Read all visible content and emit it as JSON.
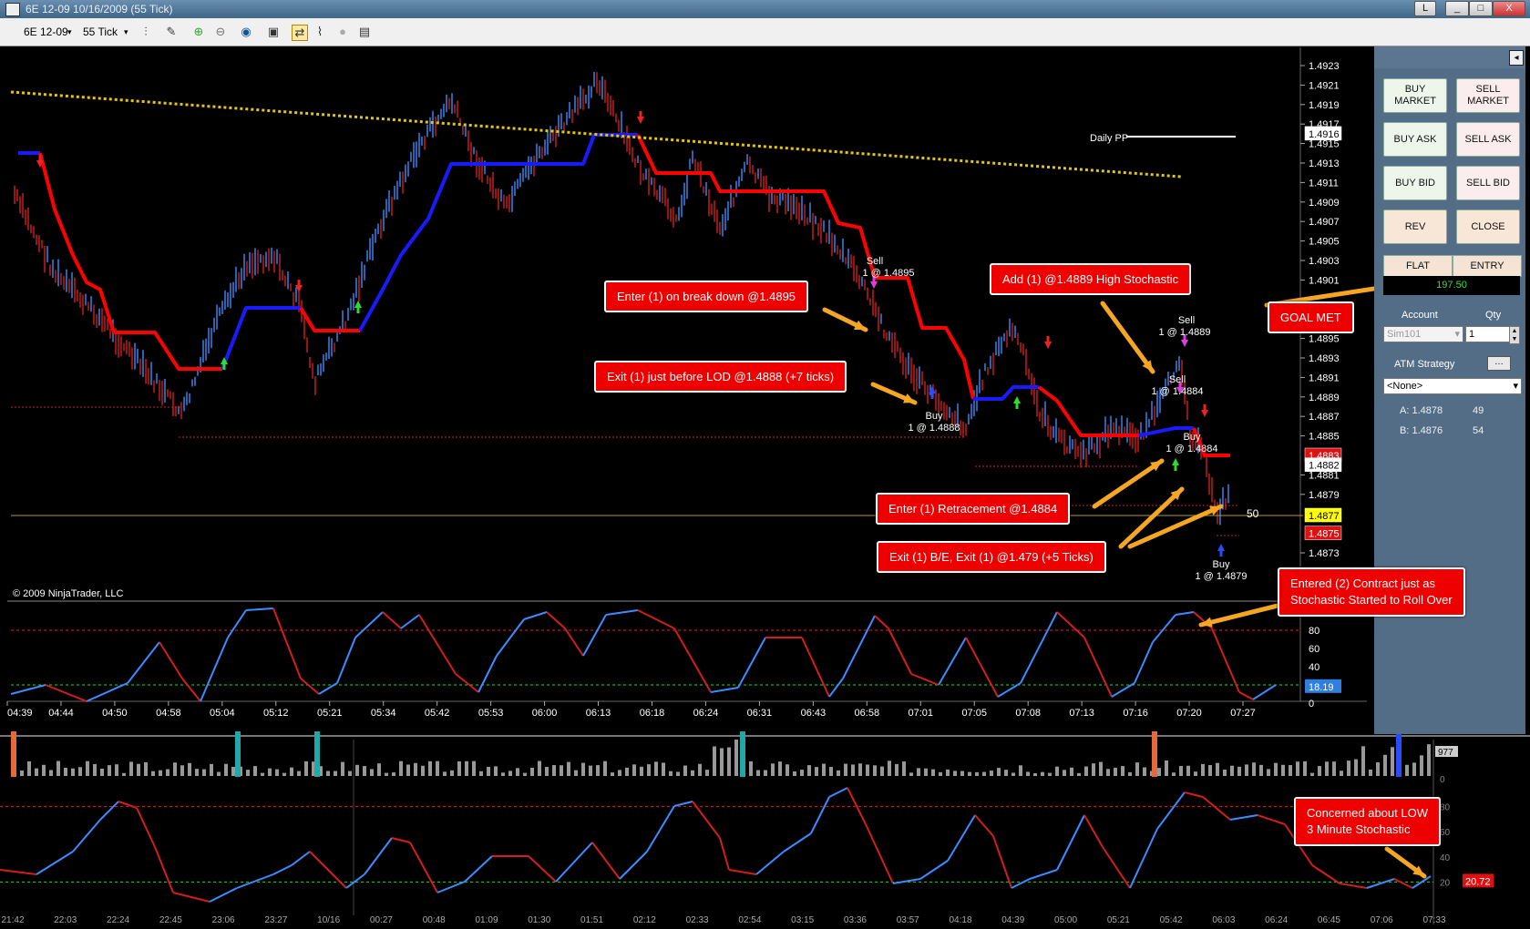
{
  "window": {
    "title": "6E 12-09  10/16/2009 (55 Tick)",
    "buttons": [
      "L",
      "_",
      "□",
      "X"
    ]
  },
  "toolbar": {
    "instrument": "6E 12-09",
    "interval": "55 Tick"
  },
  "chart": {
    "copyright": "© 2009 NinjaTrader, LLC",
    "daily_pp_label": "Daily PP",
    "price_axis": [
      "1.4923",
      "1.4921",
      "1.4919",
      "1.4917",
      "1.4915",
      "1.4913",
      "1.4911",
      "1.4909",
      "1.4907",
      "1.4905",
      "1.4903",
      "1.4901",
      "1.4895",
      "1.4893",
      "1.4891",
      "1.4889",
      "1.4887",
      "1.4885",
      "1.4881",
      "1.4879",
      "1.4873"
    ],
    "price_tags": {
      "ask": "1.4883",
      "last_a": "1.4882",
      "last": "1.4877",
      "bid": "1.4875",
      "pp": "1.4916"
    },
    "range_label": "50",
    "time_axis": [
      "04:39",
      "04:44",
      "04:50",
      "04:58",
      "05:04",
      "05:12",
      "05:21",
      "05:34",
      "05:42",
      "05:53",
      "06:00",
      "06:13",
      "06:18",
      "06:24",
      "06:31",
      "06:43",
      "06:58",
      "07:01",
      "07:05",
      "07:08",
      "07:13",
      "07:16",
      "07:20",
      "07:27"
    ],
    "stoch_axis": [
      "80",
      "60",
      "40",
      "20",
      "0"
    ],
    "stoch_value": "18.19",
    "trade_labels": [
      {
        "side": "Sell",
        "detail": "1 @ 1.4895"
      },
      {
        "side": "Buy",
        "detail": "1 @ 1.4888"
      },
      {
        "side": "Sell",
        "detail": "1 @ 1.4889"
      },
      {
        "side": "Sell",
        "detail": "1 @ 1.4884"
      },
      {
        "side": "Buy",
        "detail": "1 @ 1.4884"
      },
      {
        "side": "Buy",
        "detail": "1 @ 1.4879"
      }
    ]
  },
  "annotations": {
    "enter_break": "Enter (1) on break down @1.4895",
    "exit_lod": "Exit (1) just before LOD @1.4888 (+7 ticks)",
    "add_high": "Add (1) @1.4889 High Stochastic",
    "goal_met": "GOAL MET",
    "enter_retr": "Enter (1) Retracement @1.4884",
    "exit_be": "Exit (1) B/E, Exit (1) @1.479 (+5 Ticks)",
    "entered_two_1": "Entered (2) Contract just as",
    "entered_two_2": "Stochastic Started to Roll Over",
    "concerned_1": "Concerned about LOW",
    "concerned_2": "3 Minute Stochastic"
  },
  "order_panel": {
    "buy_market": "BUY MARKET",
    "sell_market": "SELL MARKET",
    "buy_ask": "BUY ASK",
    "sell_ask": "SELL ASK",
    "buy_bid": "BUY BID",
    "sell_bid": "SELL BID",
    "rev": "REV",
    "close": "CLOSE",
    "flat": "FLAT",
    "entry": "ENTRY",
    "pnl": "197.50",
    "account_label": "Account",
    "qty_label": "Qty",
    "account_value": "Sim101",
    "qty_value": "1",
    "atm_label": "ATM Strategy",
    "atm_value": "<None>",
    "ask_label": "A: 1.4878",
    "ask_size": "49",
    "bid_label": "B: 1.4876",
    "bid_size": "54"
  },
  "lower_chart": {
    "volume_tag": "977",
    "volume_zero": "0",
    "stoch_axis": [
      "80",
      "60",
      "40",
      "20"
    ],
    "stoch_value": "20.72",
    "time_axis": [
      "21:42",
      "22:03",
      "22:24",
      "22:45",
      "23:06",
      "23:27",
      "10/16",
      "00:27",
      "00:48",
      "01:09",
      "01:30",
      "01:51",
      "02:12",
      "02:33",
      "02:54",
      "03:15",
      "03:36",
      "03:57",
      "04:18",
      "04:39",
      "05:00",
      "05:21",
      "05:42",
      "06:03",
      "06:24",
      "06:45",
      "07:06",
      "07:33"
    ]
  },
  "colors": {
    "up_bar": "#3c8cff",
    "down_bar": "#d21e1e",
    "trail_red": "#ff0000",
    "trail_blue": "#1a1aff",
    "pp_line": "#e6c800",
    "annot_bg": "#e00000",
    "arrow": "#f5a623"
  }
}
